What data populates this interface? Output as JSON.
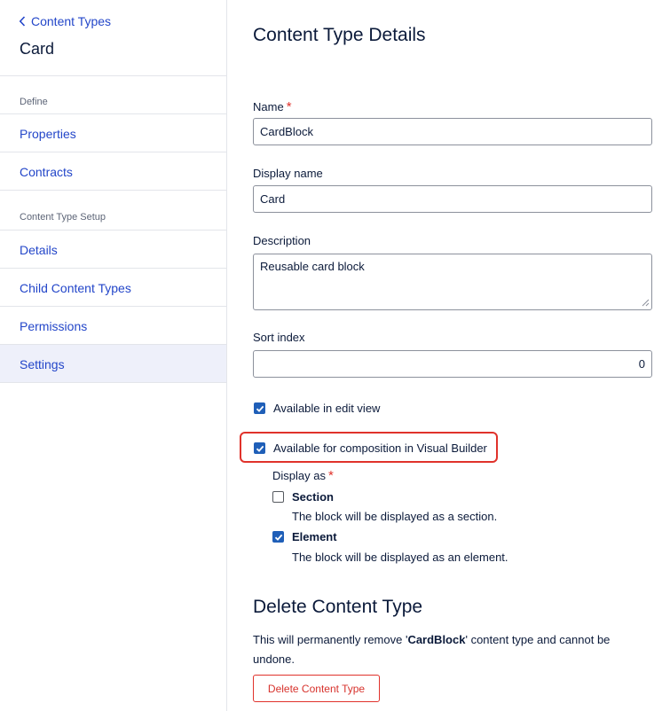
{
  "sidebar": {
    "back_label": "Content Types",
    "title": "Card",
    "section_define": "Define",
    "section_setup": "Content Type Setup",
    "items": [
      {
        "label": "Properties"
      },
      {
        "label": "Contracts"
      },
      {
        "label": "Details"
      },
      {
        "label": "Child Content Types"
      },
      {
        "label": "Permissions"
      },
      {
        "label": "Settings",
        "active": true
      }
    ]
  },
  "main": {
    "title": "Content Type Details",
    "name": {
      "label": "Name",
      "required_mark": "*",
      "value": "CardBlock"
    },
    "display_name": {
      "label": "Display name",
      "value": "Card"
    },
    "description": {
      "label": "Description",
      "value": "Reusable card block"
    },
    "sort_index": {
      "label": "Sort index",
      "value": "0"
    },
    "available_edit_view": {
      "label": "Available in edit view",
      "checked": true
    },
    "available_visual_builder": {
      "label": "Available for composition in Visual Builder",
      "checked": true
    },
    "display_as": {
      "label": "Display as",
      "required_mark": "*",
      "options": [
        {
          "label": "Section",
          "description": "The block will be displayed as a section.",
          "checked": false
        },
        {
          "label": "Element",
          "description": "The block will be displayed as an element.",
          "checked": true
        }
      ]
    },
    "delete_section": {
      "title": "Delete Content Type",
      "text_prefix": "This will permanently remove '",
      "text_name": "CardBlock",
      "text_suffix": "' content type and cannot be undone.",
      "button_label": "Delete Content Type"
    }
  },
  "colors": {
    "link": "#2346c9",
    "text": "#0b1a3a",
    "checkbox": "#1f5fb8",
    "danger": "#e0322b",
    "active_bg": "#eef0fa"
  }
}
